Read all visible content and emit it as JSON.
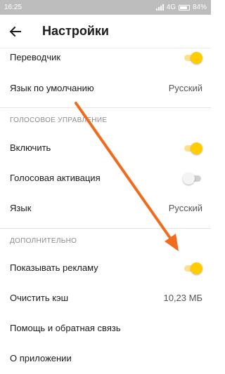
{
  "status_bar": {
    "time": "16:25",
    "network": "4G",
    "battery": "84%"
  },
  "header": {
    "title": "Настройки"
  },
  "rows": {
    "translator": {
      "label": "Переводчик",
      "toggle": true
    },
    "default_language": {
      "label": "Язык по умолчанию",
      "value": "Русский"
    },
    "voice_enable": {
      "label": "Включить",
      "toggle": true
    },
    "voice_activation": {
      "label": "Голосовая активация",
      "toggle": false
    },
    "voice_language": {
      "label": "Язык",
      "value": "Русский"
    },
    "show_ads": {
      "label": "Показывать рекламу",
      "toggle": true
    },
    "clear_cache": {
      "label": "Очистить кэш",
      "value": "10,23 МБ"
    },
    "help": {
      "label": "Помощь и обратная связь"
    },
    "about": {
      "label": "О приложении"
    }
  },
  "sections": {
    "voice": "ГОЛОСОВОЕ УПРАВЛЕНИЕ",
    "extra": "ДОПОЛНИТЕЛЬНО"
  },
  "colors": {
    "accent": "#ffcc00",
    "annotation_arrow": "#f26a1b"
  }
}
